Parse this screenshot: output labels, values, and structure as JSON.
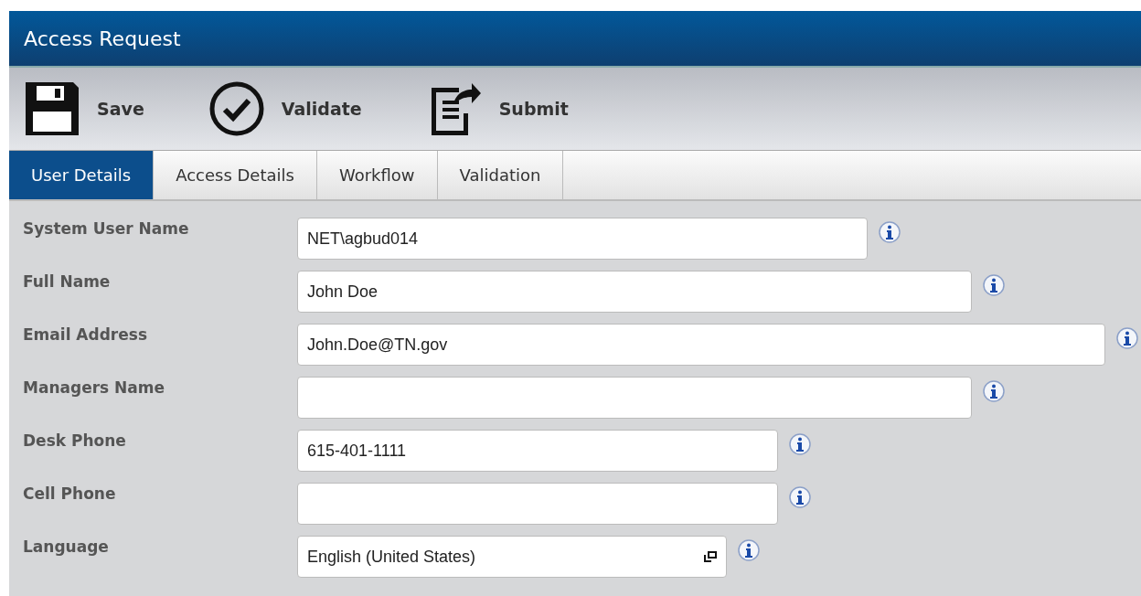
{
  "window": {
    "title": "Access Request"
  },
  "toolbar": [
    {
      "kind": "save",
      "label": "Save"
    },
    {
      "kind": "validate",
      "label": "Validate"
    },
    {
      "kind": "submit",
      "label": "Submit"
    }
  ],
  "tabs": [
    {
      "label": "User Details",
      "selected": true
    },
    {
      "label": "Access Details",
      "selected": false
    },
    {
      "label": "Workflow",
      "selected": false
    },
    {
      "label": "Validation",
      "selected": false
    }
  ],
  "fields": [
    {
      "label": "System User Name",
      "kind": "text",
      "value": "NET\\agbud014"
    },
    {
      "label": "Full Name",
      "kind": "text",
      "value": "John Doe"
    },
    {
      "label": "Email Address",
      "kind": "text",
      "value": "John.Doe@TN.gov"
    },
    {
      "label": "Managers Name",
      "kind": "text"
    },
    {
      "label": "Desk Phone",
      "kind": "text",
      "value": "615-401-1111"
    },
    {
      "label": "Cell Phone",
      "kind": "text"
    },
    {
      "label": "Language",
      "kind": "select",
      "value": "English (United States)"
    }
  ]
}
